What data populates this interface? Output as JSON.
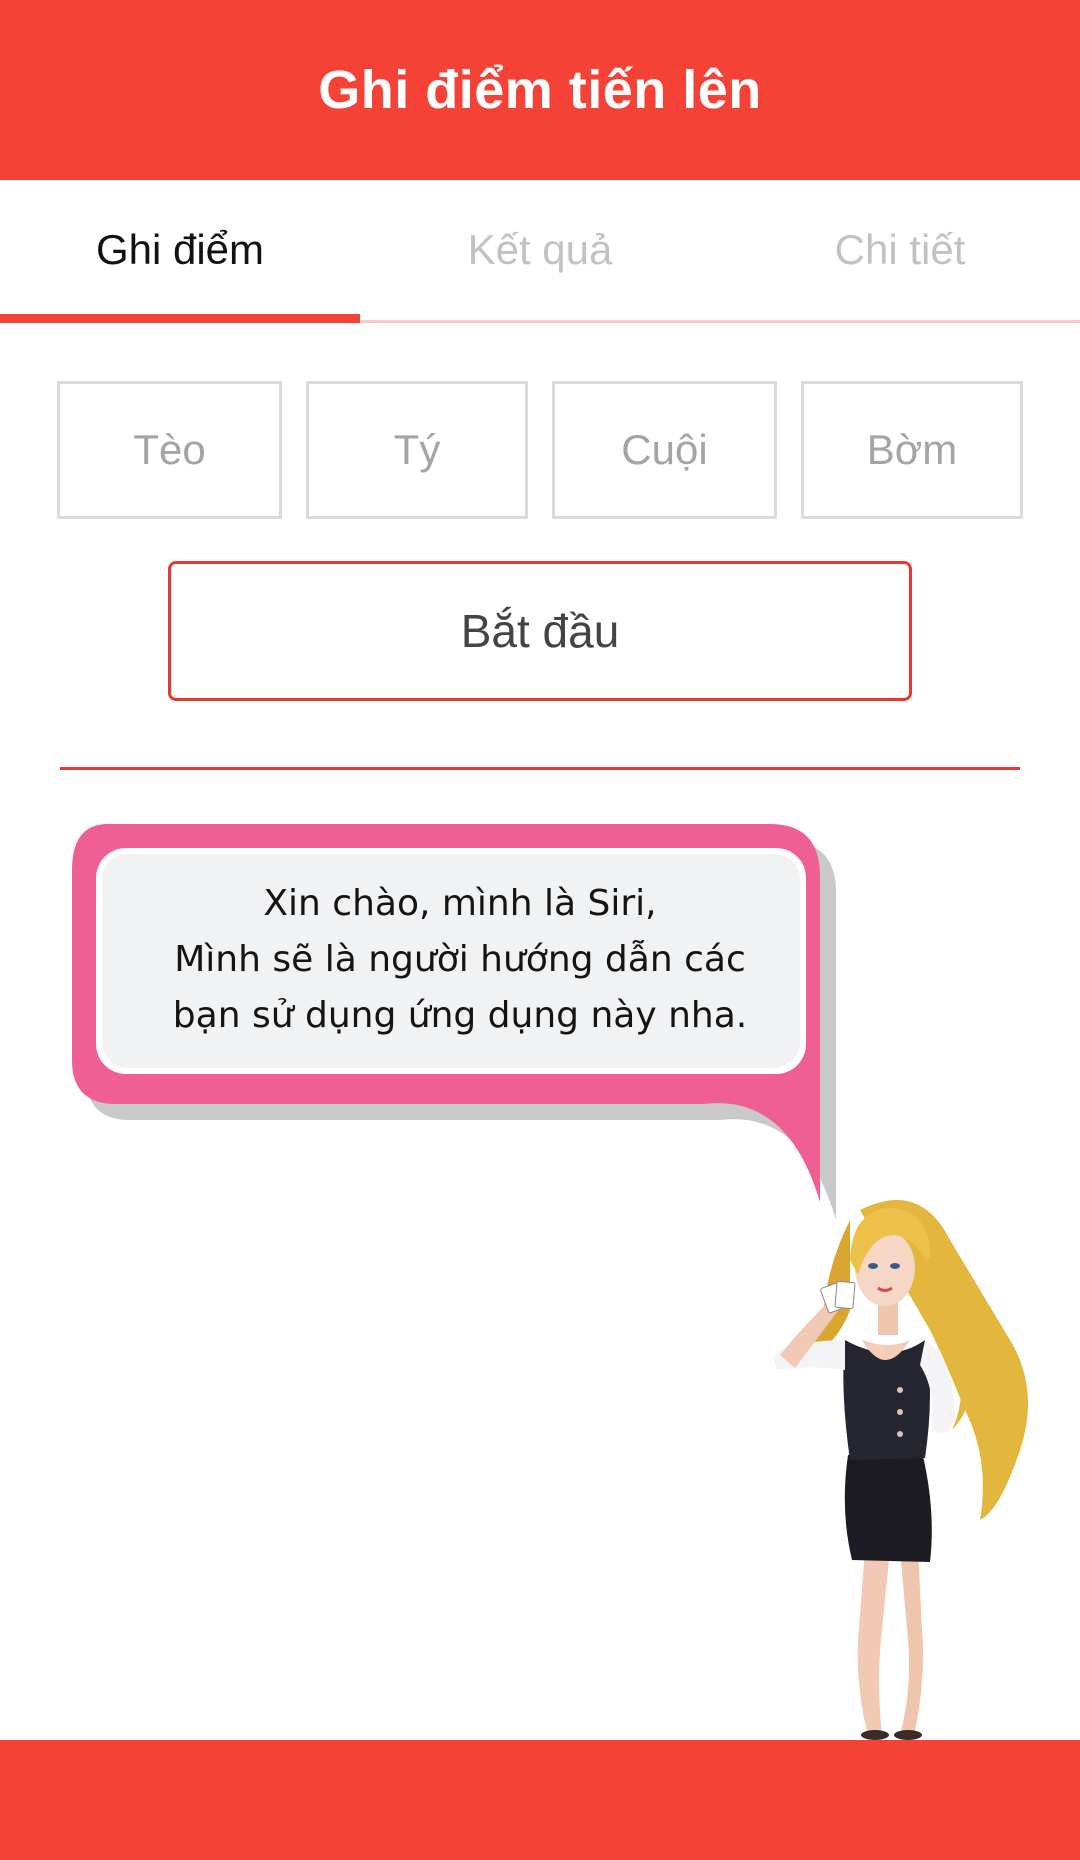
{
  "app_bar": {
    "title": "Ghi điểm tiến lên"
  },
  "tabs": [
    {
      "label": "Ghi điểm",
      "active": true
    },
    {
      "label": "Kết quả",
      "active": false
    },
    {
      "label": "Chi tiết",
      "active": false
    }
  ],
  "players": [
    {
      "placeholder": "Tèo"
    },
    {
      "placeholder": "Tý"
    },
    {
      "placeholder": "Cuội"
    },
    {
      "placeholder": "Bờm"
    }
  ],
  "start_button": {
    "label": "Bắt đầu"
  },
  "guide": {
    "lines": [
      "Xin chào, mình là Siri,",
      "Mình sẽ là người hướng dẫn các",
      "bạn sử dụng ứng dụng này nha."
    ]
  },
  "colors": {
    "accent": "#f44336",
    "bubble_border": "#ef5f93",
    "bubble_fill": "#f2f3f4"
  }
}
